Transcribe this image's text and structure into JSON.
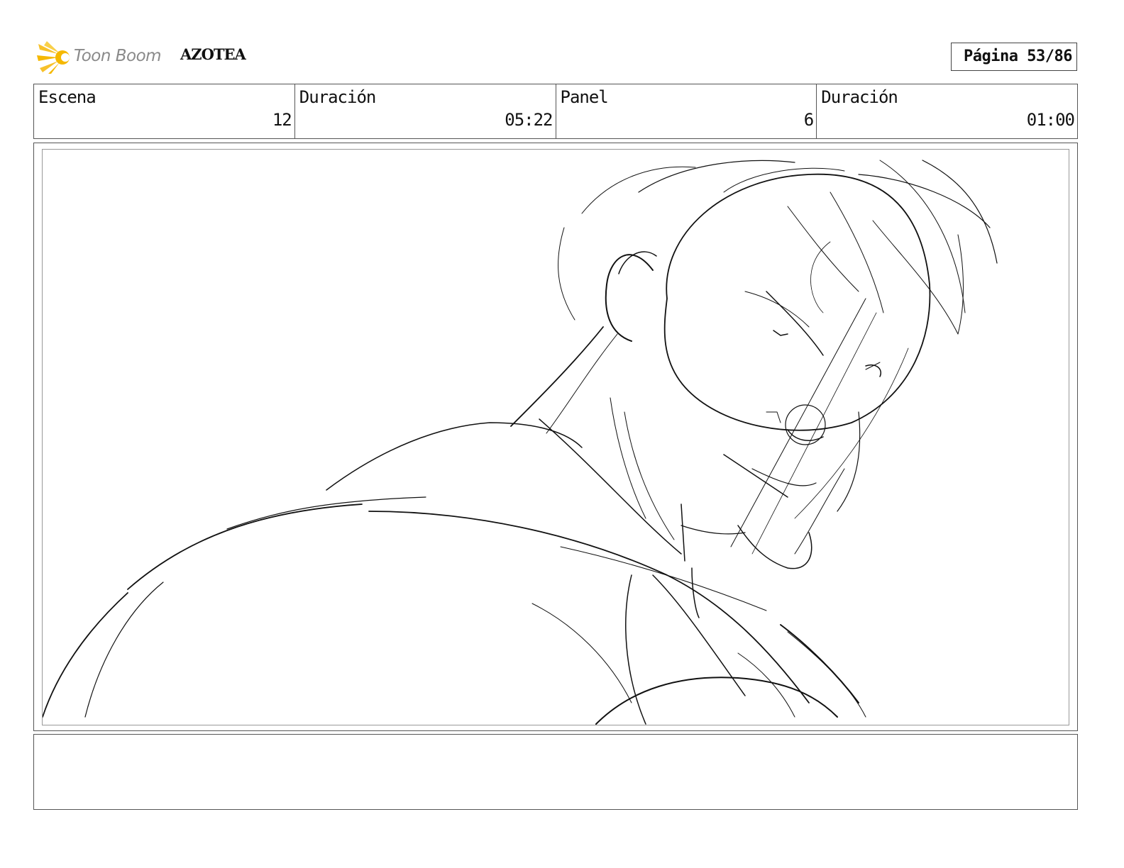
{
  "header": {
    "logo_text": "Toon Boom",
    "project_title": "AZOTEA",
    "page_label": "Página 53/86"
  },
  "info": {
    "scene_label": "Escena",
    "scene_value": "12",
    "scene_duration_label": "Duración",
    "scene_duration_value": "05:22",
    "panel_label": "Panel",
    "panel_value": "6",
    "panel_duration_label": "Duración",
    "panel_duration_value": "01:00"
  },
  "colors": {
    "logo_accent": "#f5b800",
    "logo_text": "#8a8a8a",
    "border": "#555555"
  },
  "notes": {
    "text": ""
  }
}
